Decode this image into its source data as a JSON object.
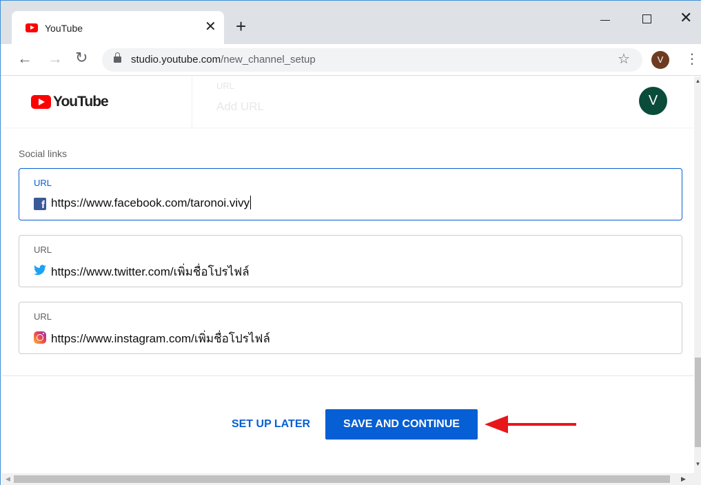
{
  "browser": {
    "tab_title": "YouTube",
    "tab_close": "✕",
    "new_tab": "+",
    "url_host": "studio.youtube.com",
    "url_path": "/new_channel_setup",
    "profile_initial": "V",
    "window_controls": {
      "minimize": "minimize",
      "maximize": "maximize",
      "close": "✕"
    }
  },
  "header": {
    "logo_text": "YouTube",
    "avatar_initial": "V",
    "ghost_label": "URL",
    "ghost_value": "Add URL"
  },
  "social": {
    "section_label": "Social links",
    "fields": [
      {
        "label": "URL",
        "value": "https://www.facebook.com/taronoi.vivy",
        "icon": "facebook-icon",
        "focused": true
      },
      {
        "label": "URL",
        "value": "https://www.twitter.com/เพิ่มชื่อโปรไฟล์",
        "icon": "twitter-icon",
        "focused": false
      },
      {
        "label": "URL",
        "value": "https://www.instagram.com/เพิ่มชื่อโปรไฟล์",
        "icon": "instagram-icon",
        "focused": false
      }
    ]
  },
  "actions": {
    "setup_later": "SET UP LATER",
    "save_continue": "SAVE AND CONTINUE"
  },
  "colors": {
    "accent": "#065fd4",
    "youtube_red": "#ff0000",
    "annotation_arrow": "#e8161b",
    "channel_avatar": "#0b4b39",
    "profile_avatar": "#6d3b21"
  }
}
